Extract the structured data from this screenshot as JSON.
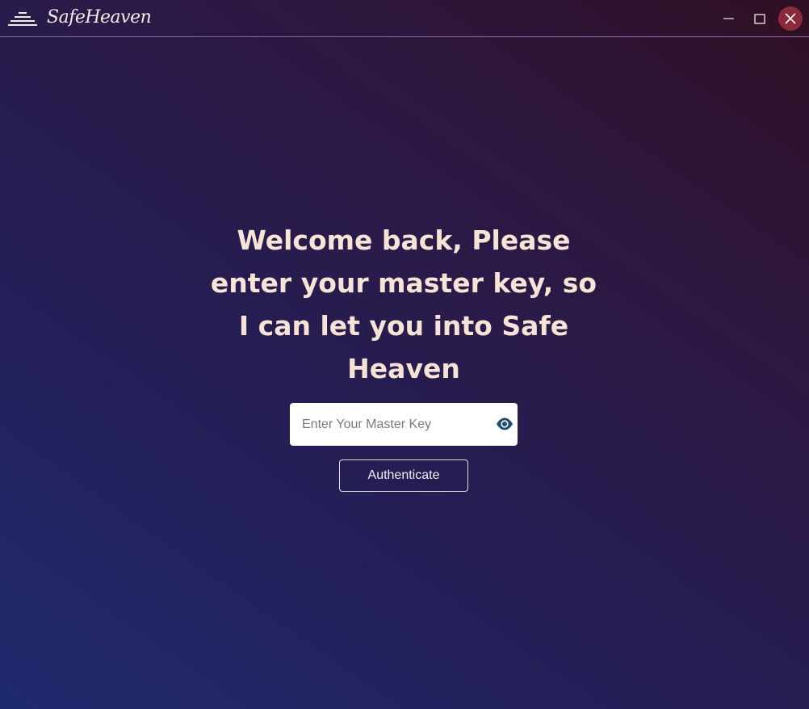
{
  "titlebar": {
    "app_name": "SafeHeaven",
    "logo_icon": "stacked-lines-logo",
    "controls": {
      "minimize_icon": "minimize-icon",
      "maximize_icon": "maximize-icon",
      "close_icon": "close-icon"
    }
  },
  "login": {
    "headline": "Welcome back, Please enter your master key, so I can let you into Safe Heaven",
    "key_placeholder": "Enter Your Master Key",
    "key_value": "",
    "toggle_visibility_icon": "eye-icon",
    "authenticate_label": "Authenticate"
  },
  "colors": {
    "headline_text": "#f7e4d6",
    "eye_icon": "#1f4e72",
    "close_button_bg": "#8a2a3a",
    "gradient_start": "#1f2a6e",
    "gradient_end": "#300f22"
  }
}
